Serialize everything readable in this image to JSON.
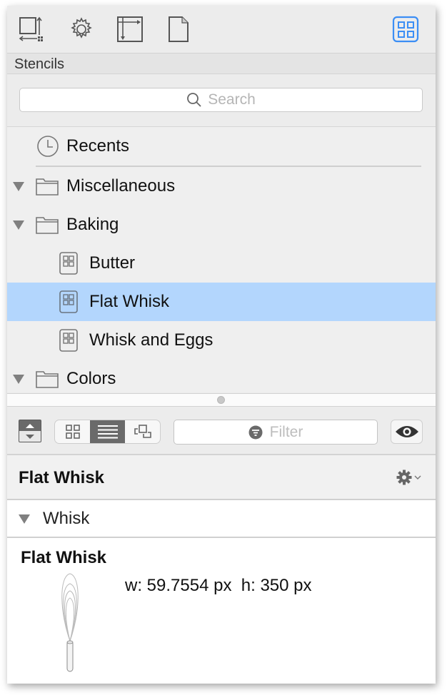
{
  "toolbar": {
    "tools": [
      {
        "name": "canvas-size-icon",
        "label": "Canvas Size"
      },
      {
        "name": "gear-icon",
        "label": "Settings"
      },
      {
        "name": "layout-icon",
        "label": "Layout"
      },
      {
        "name": "document-icon",
        "label": "Document"
      },
      {
        "name": "stencils-icon",
        "label": "Stencils",
        "active": true
      }
    ],
    "accent_color": "#3b8ef5"
  },
  "stencils": {
    "header": "Stencils",
    "search_placeholder": "Search",
    "tree": [
      {
        "label": "Recents",
        "icon": "clock-icon",
        "level": 0
      },
      {
        "label": "Miscellaneous",
        "icon": "folder-icon",
        "level": 0,
        "expanded": true
      },
      {
        "label": "Baking",
        "icon": "folder-icon",
        "level": 0,
        "expanded": true
      },
      {
        "label": "Butter",
        "icon": "stencil-icon",
        "level": 1
      },
      {
        "label": "Flat Whisk",
        "icon": "stencil-icon",
        "level": 1,
        "selected": true
      },
      {
        "label": "Whisk and Eggs",
        "icon": "stencil-icon",
        "level": 1
      },
      {
        "label": "Colors",
        "icon": "folder-icon",
        "level": 0,
        "expanded": true
      }
    ],
    "selection_color": "#b3d6fd"
  },
  "filterbar": {
    "view_modes": [
      "grid",
      "list",
      "shapes"
    ],
    "active_view": "list",
    "filter_placeholder": "Filter"
  },
  "inspector": {
    "title": "Flat Whisk",
    "section": "Whisk",
    "item": {
      "name": "Flat Whisk",
      "dimensions": "w: 59.7554 px  h: 350 px"
    }
  }
}
